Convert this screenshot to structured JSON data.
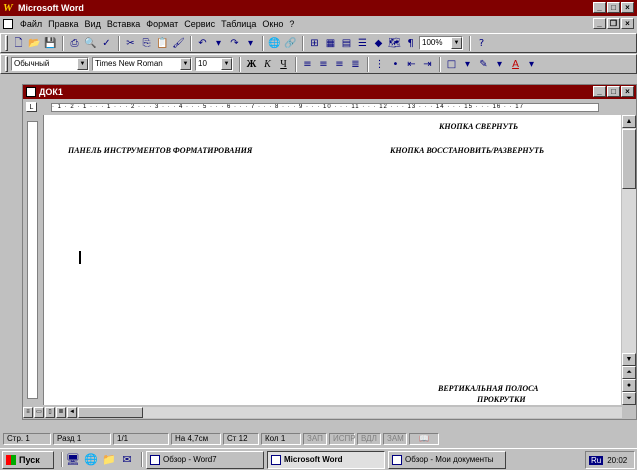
{
  "app": {
    "title": "Microsoft Word"
  },
  "menu": {
    "items": [
      "Файл",
      "Правка",
      "Вид",
      "Вставка",
      "Формат",
      "Сервис",
      "Таблица",
      "Окно",
      "?"
    ]
  },
  "toolbar_standard": {
    "zoom_value": "100%"
  },
  "toolbar_format": {
    "style_value": "Обычный",
    "font_value": "Times New Roman",
    "size_value": "10",
    "bold_label": "Ж",
    "italic_label": "К",
    "underline_label": "Ч",
    "font_color_label": "А"
  },
  "document": {
    "title": "ДОК1",
    "ruler_text": "· 1 · 2 · 1 · · · 1 · · · 2 · · · 3 · · · 4 · · · 5 · · · 6 · · · 7 · · · 8 · · · 9 · · · 10 · · · 11 · · · 12 · · · 13 · · · 14 · · · 15 · · · 16 · · 17",
    "annotations": {
      "collapse": "КНОПКА СВЕРНУТЬ",
      "format_toolbar": "ПАНЕЛЬ ИНСТРУМЕНТОВ ФОРМАТИРОВАНИЯ",
      "restore": "КНОПКА ВОССТАНОВИТЬ/РАЗВЕРНУТЬ",
      "vscroll_line1": "ВЕРТИКАЛЬНАЯ ПОЛОСА",
      "vscroll_line2": "ПРОКРУТКИ"
    }
  },
  "statusbar": {
    "page": "Стр. 1",
    "section": "Разд 1",
    "pages": "1/1",
    "position": "На 4,7см",
    "line": "Ст 12",
    "column": "Кол 1",
    "rec": "ЗАП",
    "trk": "ИСПР",
    "ext": "ВДЛ",
    "ovr": "ЗАМ"
  },
  "taskbar": {
    "start_label": "Пуск",
    "items": [
      {
        "label": "Обзор - Word7"
      },
      {
        "label": "Microsoft Word"
      },
      {
        "label": "Обзор - Мои документы"
      }
    ],
    "lang": "Ru",
    "clock": "20:02"
  }
}
